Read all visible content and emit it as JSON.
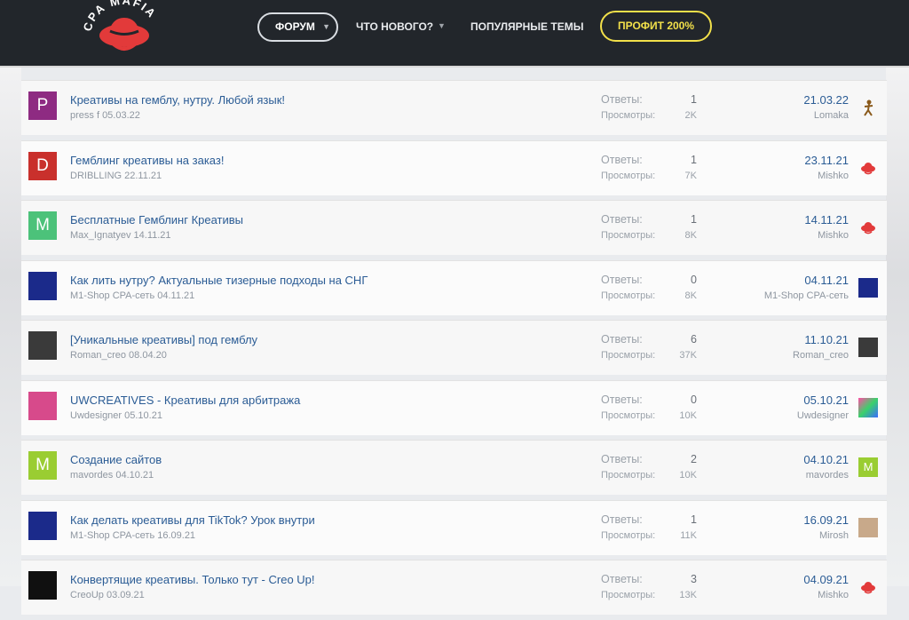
{
  "header": {
    "logo_text": "CPA MAFIA",
    "nav": {
      "forum_label": "ФОРУМ",
      "whats_new_label": "ЧТО НОВОГО?",
      "popular_label": "ПОПУЛЯРНЫЕ ТЕМЫ",
      "profit_label": "ПРОФИТ 200%"
    }
  },
  "threads": [
    {
      "avatar_letter": "P",
      "avatar_color": "#8e2b82",
      "title": "Креативы на гемблу, нутру. Любой язык!",
      "meta": "press f 05.03.22",
      "replies_label": "Ответы:",
      "replies": "1",
      "views_label": "Просмотры:",
      "views": "2K",
      "last_date": "21.03.22",
      "last_user": "Lomaka",
      "last_avatar": "stick-figure"
    },
    {
      "avatar_letter": "D",
      "avatar_color": "#c9302c",
      "title": "Гемблинг креативы на заказ!",
      "meta": "DRIBLLING 22.11.21",
      "replies_label": "Ответы:",
      "replies": "1",
      "views_label": "Просмотры:",
      "views": "7K",
      "last_date": "23.11.21",
      "last_user": "Mishko",
      "last_avatar": "red-hat-logo"
    },
    {
      "avatar_letter": "M",
      "avatar_color": "#4cc27a",
      "title": "Бесплатные Гемблинг Креативы",
      "meta": "Max_Ignatyev 14.11.21",
      "replies_label": "Ответы:",
      "replies": "1",
      "views_label": "Просмотры:",
      "views": "8K",
      "last_date": "14.11.21",
      "last_user": "Mishko",
      "last_avatar": "red-hat-logo"
    },
    {
      "avatar_letter": "",
      "avatar_color": "#1b2a8a",
      "title": "Как лить нутру? Актуальные тизерные подходы на СНГ",
      "meta": "M1-Shop CPA-сеть 04.11.21",
      "replies_label": "Ответы:",
      "replies": "0",
      "views_label": "Просмотры:",
      "views": "8K",
      "last_date": "04.11.21",
      "last_user": "M1-Shop CPA-сеть",
      "last_avatar": "m1-logo"
    },
    {
      "avatar_letter": "",
      "avatar_color": "#3a3a3a",
      "title": "[Уникальные креативы] под гемблу",
      "meta": "Roman_creo 08.04.20",
      "replies_label": "Ответы:",
      "replies": "6",
      "views_label": "Просмотры:",
      "views": "37K",
      "last_date": "11.10.21",
      "last_user": "Roman_creo",
      "last_avatar": "photo-man"
    },
    {
      "avatar_letter": "",
      "avatar_color": "#d74a8b",
      "title": "UWCREATIVES - Креативы для арбитража",
      "meta": "Uwdesigner 05.10.21",
      "replies_label": "Ответы:",
      "replies": "0",
      "views_label": "Просмотры:",
      "views": "10K",
      "last_date": "05.10.21",
      "last_user": "Uwdesigner",
      "last_avatar": "pixel-art"
    },
    {
      "avatar_letter": "M",
      "avatar_color": "#9acd32",
      "title": "Создание сайтов",
      "meta": "mavordes 04.10.21",
      "replies_label": "Ответы:",
      "replies": "2",
      "views_label": "Просмотры:",
      "views": "10K",
      "last_date": "04.10.21",
      "last_user": "mavordes",
      "last_avatar": "letter-m"
    },
    {
      "avatar_letter": "",
      "avatar_color": "#1b2a8a",
      "title": "Как делать креативы для TikTok? Урок внутри",
      "meta": "M1-Shop CPA-сеть 16.09.21",
      "replies_label": "Ответы:",
      "replies": "1",
      "views_label": "Просмотры:",
      "views": "11K",
      "last_date": "16.09.21",
      "last_user": "Mirosh",
      "last_avatar": "photo-person"
    },
    {
      "avatar_letter": "",
      "avatar_color": "#101010",
      "title": "Конвертящие креативы. Только тут - Creo Up!",
      "meta": "CreoUp 03.09.21",
      "replies_label": "Ответы:",
      "replies": "3",
      "views_label": "Просмотры:",
      "views": "13K",
      "last_date": "04.09.21",
      "last_user": "Mishko",
      "last_avatar": "red-hat-logo"
    }
  ]
}
